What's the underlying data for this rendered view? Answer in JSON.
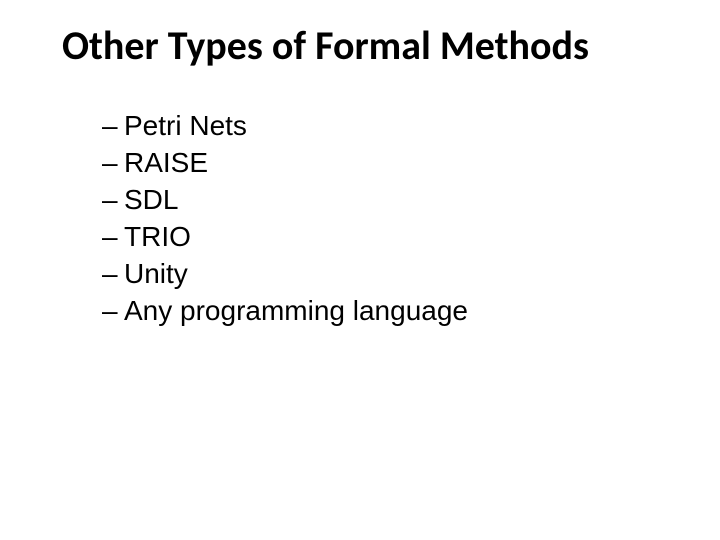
{
  "title": "Other Types of Formal Methods",
  "bullets": [
    {
      "dash": "–",
      "text": "Petri Nets"
    },
    {
      "dash": "–",
      "text": "RAISE"
    },
    {
      "dash": "–",
      "text": "SDL"
    },
    {
      "dash": "–",
      "text": "TRIO"
    },
    {
      "dash": "–",
      "text": "Unity"
    },
    {
      "dash": "–",
      "text": "Any programming language"
    }
  ]
}
